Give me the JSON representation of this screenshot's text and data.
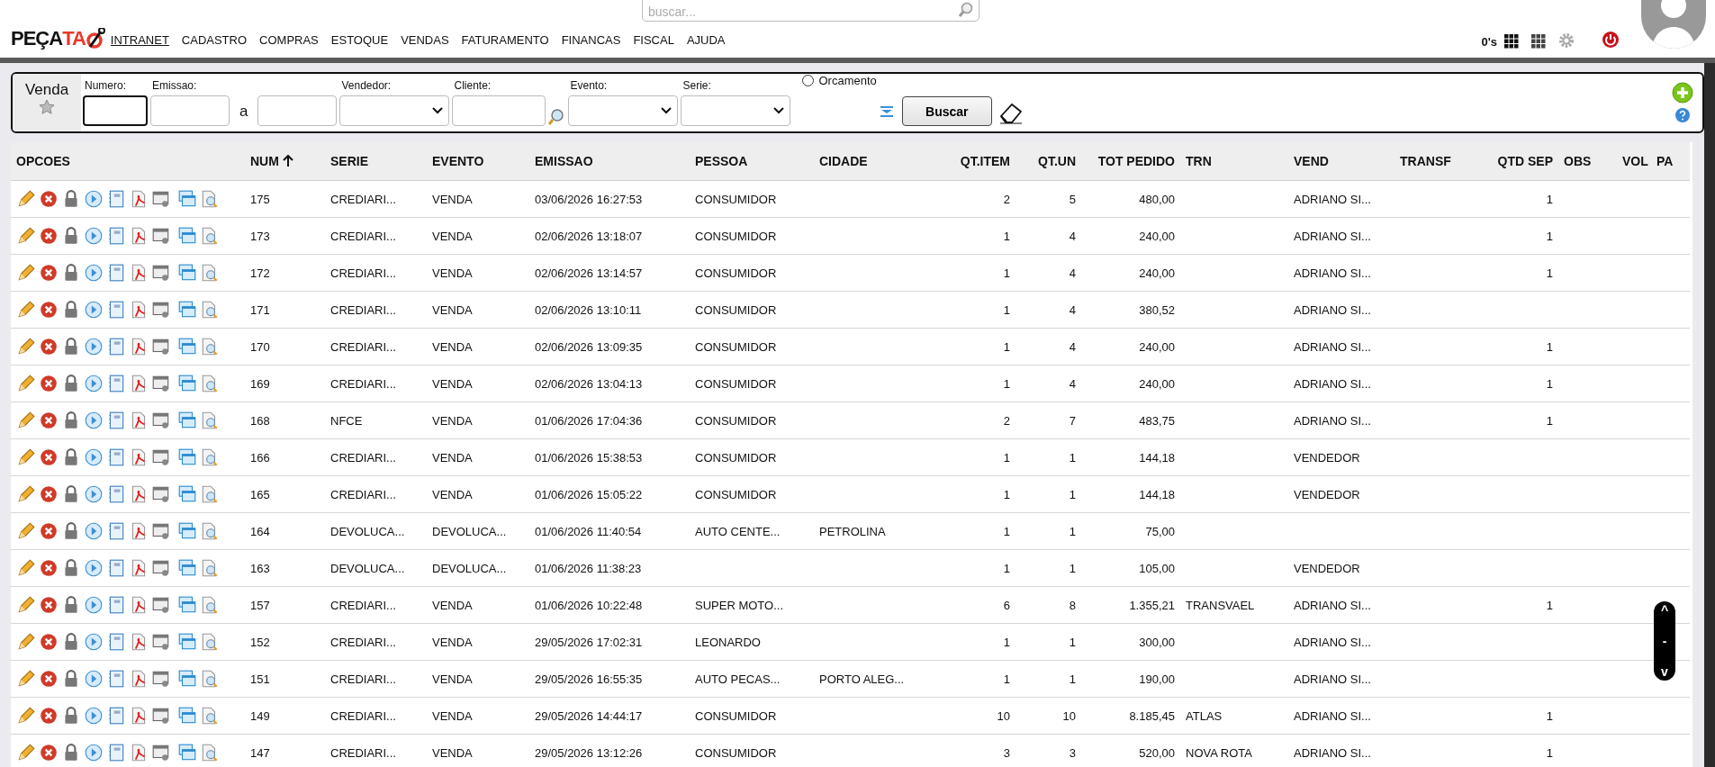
{
  "header": {
    "logo": {
      "dark": "PEÇA",
      "red": "TA"
    },
    "search": {
      "placeholder": "buscar..."
    },
    "menu": [
      {
        "label": "INTRANET",
        "selected": true
      },
      {
        "label": "CADASTRO",
        "selected": false
      },
      {
        "label": "COMPRAS",
        "selected": false
      },
      {
        "label": "ESTOQUE",
        "selected": false
      },
      {
        "label": "VENDAS",
        "selected": false
      },
      {
        "label": "FATURAMENTO",
        "selected": false
      },
      {
        "label": "FINANCAS",
        "selected": false
      },
      {
        "label": "FISCAL",
        "selected": false
      },
      {
        "label": "AJUDA",
        "selected": false
      }
    ],
    "counter": "0's"
  },
  "filter": {
    "title": "Venda",
    "fields": [
      {
        "label": "Numero:",
        "kind": "text",
        "focused": true
      },
      {
        "label": "Emissao:",
        "kind": "text",
        "focused": false
      },
      {
        "separator": "a",
        "kind": "text",
        "focused": false
      },
      {
        "label": "Vendedor:",
        "kind": "select",
        "focused": false
      },
      {
        "label": "Cliente:",
        "kind": "lookup",
        "focused": false
      },
      {
        "label": "Evento:",
        "kind": "select",
        "focused": false
      },
      {
        "label": "Serie:",
        "kind": "select",
        "focused": false
      }
    ],
    "radio": {
      "label": "Orcamento",
      "checked": false
    },
    "button": "Buscar"
  },
  "table": {
    "columns": [
      {
        "label": "OPCOES"
      },
      {
        "label": "NUM",
        "sorted": true
      },
      {
        "label": "SERIE"
      },
      {
        "label": "EVENTO"
      },
      {
        "label": "EMISSAO"
      },
      {
        "label": "PESSOA"
      },
      {
        "label": "CIDADE"
      },
      {
        "label": "QT.ITEM"
      },
      {
        "label": "QT.UN"
      },
      {
        "label": "TOT PEDIDO"
      },
      {
        "label": "TRN"
      },
      {
        "label": "VEND"
      },
      {
        "label": "TRANSF"
      },
      {
        "label": "QTD SEP"
      },
      {
        "label": "OBS"
      },
      {
        "label": "VOL"
      },
      {
        "label": "PA"
      }
    ],
    "rows": [
      {
        "num": "175",
        "serie": "CREDIARI...",
        "evento": "VENDA",
        "emissao": "03/06/2026 16:27:53",
        "pessoa": "CONSUMIDOR",
        "qt_item": "2",
        "qt_un": "5",
        "tot": "480,00",
        "vend": "ADRIANO SI...",
        "qtd_sep": "1"
      },
      {
        "num": "173",
        "serie": "CREDIARI...",
        "evento": "VENDA",
        "emissao": "02/06/2026 13:18:07",
        "pessoa": "CONSUMIDOR",
        "qt_item": "1",
        "qt_un": "4",
        "tot": "240,00",
        "vend": "ADRIANO SI...",
        "qtd_sep": "1"
      },
      {
        "num": "172",
        "serie": "CREDIARI...",
        "evento": "VENDA",
        "emissao": "02/06/2026 13:14:57",
        "pessoa": "CONSUMIDOR",
        "qt_item": "1",
        "qt_un": "4",
        "tot": "240,00",
        "vend": "ADRIANO SI...",
        "qtd_sep": "1"
      },
      {
        "num": "171",
        "serie": "CREDIARI...",
        "evento": "VENDA",
        "emissao": "02/06/2026 13:10:11",
        "pessoa": "CONSUMIDOR",
        "qt_item": "1",
        "qt_un": "4",
        "tot": "380,52",
        "vend": "ADRIANO SI..."
      },
      {
        "num": "170",
        "serie": "CREDIARI...",
        "evento": "VENDA",
        "emissao": "02/06/2026 13:09:35",
        "pessoa": "CONSUMIDOR",
        "qt_item": "1",
        "qt_un": "4",
        "tot": "240,00",
        "vend": "ADRIANO SI...",
        "qtd_sep": "1"
      },
      {
        "num": "169",
        "serie": "CREDIARI...",
        "evento": "VENDA",
        "emissao": "02/06/2026 13:04:13",
        "pessoa": "CONSUMIDOR",
        "qt_item": "1",
        "qt_un": "4",
        "tot": "240,00",
        "vend": "ADRIANO SI...",
        "qtd_sep": "1"
      },
      {
        "num": "168",
        "serie": "NFCE",
        "evento": "VENDA",
        "emissao": "01/06/2026 17:04:36",
        "pessoa": "CONSUMIDOR",
        "qt_item": "2",
        "qt_un": "7",
        "tot": "483,75",
        "vend": "ADRIANO SI...",
        "qtd_sep": "1"
      },
      {
        "num": "166",
        "serie": "CREDIARI...",
        "evento": "VENDA",
        "emissao": "01/06/2026 15:38:53",
        "pessoa": "CONSUMIDOR",
        "qt_item": "1",
        "qt_un": "1",
        "tot": "144,18",
        "vend": "VENDEDOR"
      },
      {
        "num": "165",
        "serie": "CREDIARI...",
        "evento": "VENDA",
        "emissao": "01/06/2026 15:05:22",
        "pessoa": "CONSUMIDOR",
        "qt_item": "1",
        "qt_un": "1",
        "tot": "144,18",
        "vend": "VENDEDOR"
      },
      {
        "num": "164",
        "serie": "DEVOLUCA...",
        "evento": "DEVOLUCA...",
        "emissao": "01/06/2026 11:40:54",
        "pessoa": "AUTO CENTE...",
        "cidade": "PETROLINA",
        "qt_item": "1",
        "qt_un": "1",
        "tot": "75,00"
      },
      {
        "num": "163",
        "serie": "DEVOLUCA...",
        "evento": "DEVOLUCA...",
        "emissao": "01/06/2026 11:38:23",
        "qt_item": "1",
        "qt_un": "1",
        "tot": "105,00",
        "vend": "VENDEDOR"
      },
      {
        "num": "157",
        "serie": "CREDIARI...",
        "evento": "VENDA",
        "emissao": "01/06/2026 10:22:48",
        "pessoa": "SUPER MOTO...",
        "qt_item": "6",
        "qt_un": "8",
        "tot": "1.355,21",
        "trn": "TRANSVAEL",
        "vend": "ADRIANO SI...",
        "qtd_sep": "1"
      },
      {
        "num": "152",
        "serie": "CREDIARI...",
        "evento": "VENDA",
        "emissao": "29/05/2026 17:02:31",
        "pessoa": "LEONARDO",
        "qt_item": "1",
        "qt_un": "1",
        "tot": "300,00",
        "vend": "ADRIANO SI..."
      },
      {
        "num": "151",
        "serie": "CREDIARI...",
        "evento": "VENDA",
        "emissao": "29/05/2026 16:55:35",
        "pessoa": "AUTO PECAS...",
        "cidade": "PORTO ALEG...",
        "qt_item": "1",
        "qt_un": "1",
        "tot": "190,00",
        "vend": "ADRIANO SI..."
      },
      {
        "num": "149",
        "serie": "CREDIARI...",
        "evento": "VENDA",
        "emissao": "29/05/2026 14:44:17",
        "pessoa": "CONSUMIDOR",
        "qt_item": "10",
        "qt_un": "10",
        "tot": "8.185,45",
        "trn": "ATLAS",
        "vend": "ADRIANO SI...",
        "qtd_sep": "1"
      },
      {
        "num": "147",
        "serie": "CREDIARI...",
        "evento": "VENDA",
        "emissao": "29/05/2026 13:12:26",
        "pessoa": "CONSUMIDOR",
        "qt_item": "3",
        "qt_un": "3",
        "tot": "520,00",
        "trn": "NOVA ROTA",
        "vend": "ADRIANO SI...",
        "qtd_sep": "1"
      }
    ]
  },
  "scroll_widget": {
    "up": "^",
    "middle": "-",
    "down": "v"
  }
}
